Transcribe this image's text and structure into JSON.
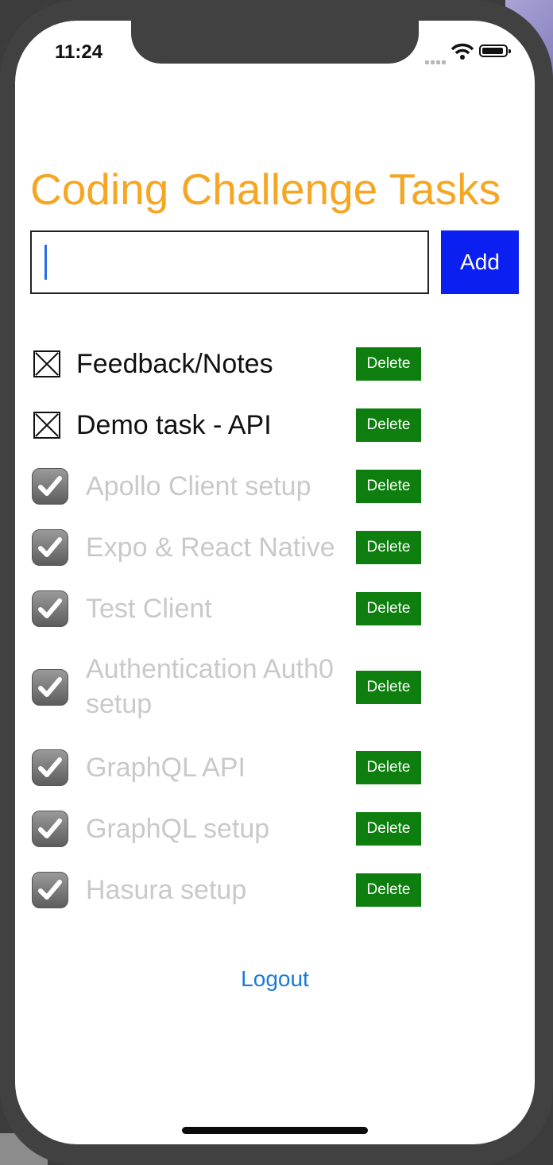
{
  "status_bar": {
    "time": "11:24"
  },
  "title": "Coding Challenge Tasks",
  "input": {
    "value": "",
    "placeholder": ""
  },
  "add_label": "Add",
  "delete_label": "Delete",
  "tasks": [
    {
      "label": "Feedback/Notes",
      "completed": false
    },
    {
      "label": "Demo task - API",
      "completed": false
    },
    {
      "label": "Apollo Client setup",
      "completed": true
    },
    {
      "label": "Expo & React Native",
      "completed": true
    },
    {
      "label": "Test Client",
      "completed": true
    },
    {
      "label": "Authentication Auth0 setup",
      "completed": true
    },
    {
      "label": "GraphQL API",
      "completed": true
    },
    {
      "label": "GraphQL setup",
      "completed": true
    },
    {
      "label": "Hasura setup",
      "completed": true
    }
  ],
  "logout_label": "Logout",
  "colors": {
    "title": "#f5a623",
    "add_button": "#0a1ff0",
    "delete_button": "#0e7e0e",
    "link": "#1a7ad8"
  }
}
